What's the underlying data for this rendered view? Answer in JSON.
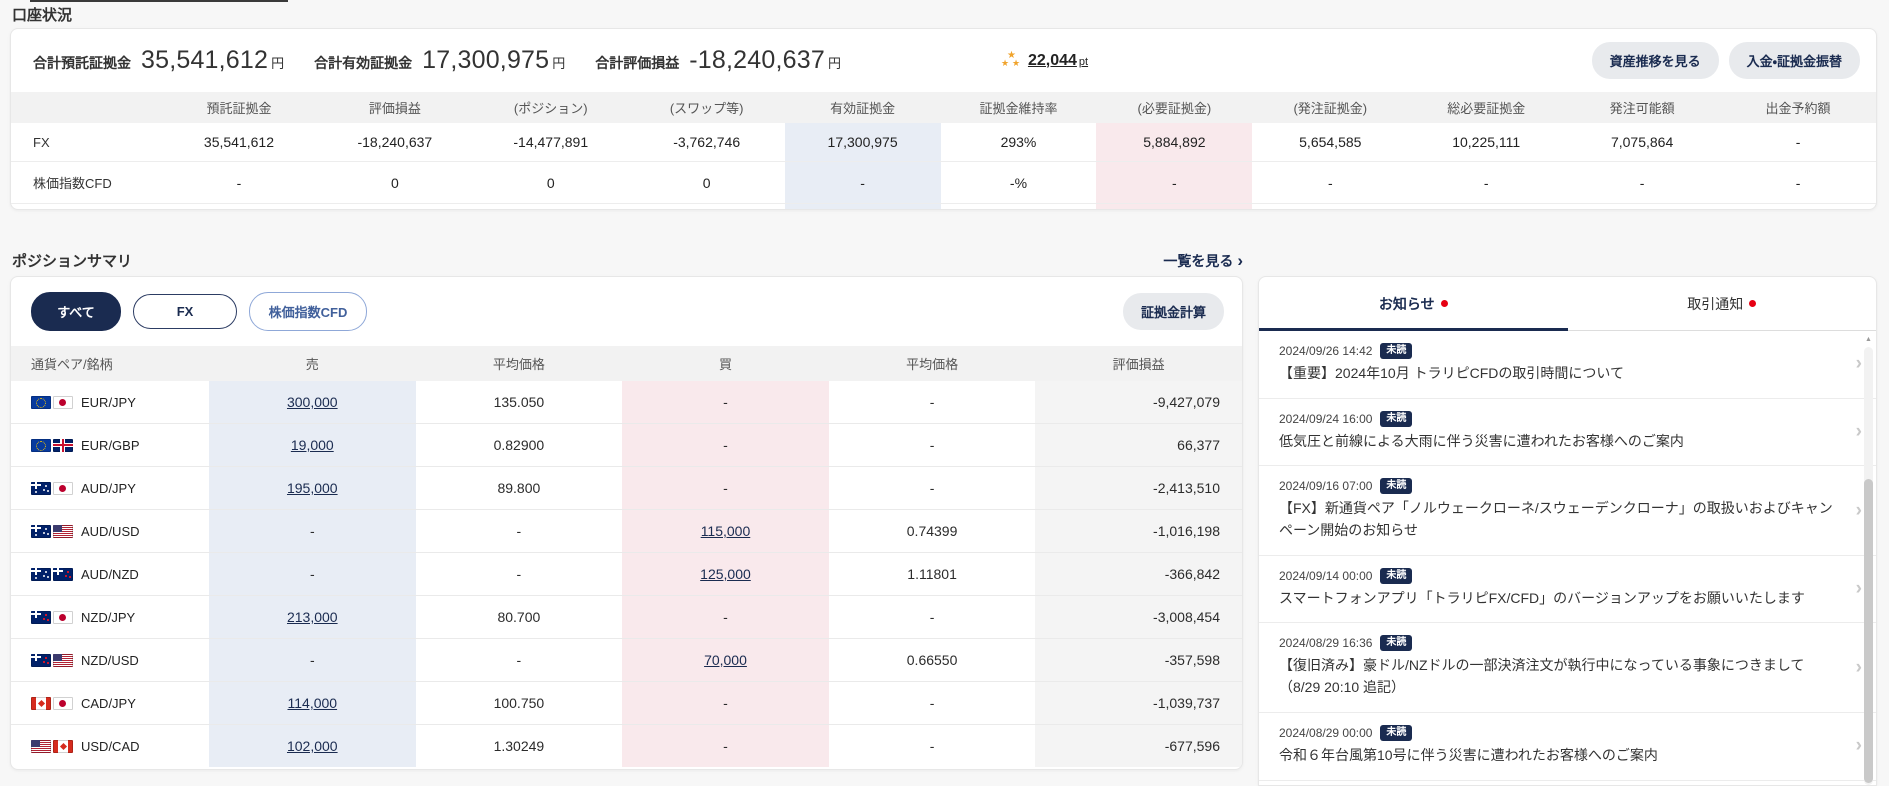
{
  "page": {
    "title": "口座状況"
  },
  "account": {
    "summary": [
      {
        "label": "合計預託証拠金",
        "value": "35,541,612",
        "unit": "円"
      },
      {
        "label": "合計有効証拠金",
        "value": "17,300,975",
        "unit": "円"
      },
      {
        "label": "合計評価損益",
        "value": "-18,240,637",
        "unit": "円"
      }
    ],
    "points": {
      "value": "22,044",
      "unit": "pt"
    },
    "buttons": {
      "asset_trend": "資産推移を見る",
      "deposit": "入金・証拠金振替"
    },
    "table": {
      "columns": [
        "",
        "預託証拠金",
        "評価損益",
        "(ポジション)",
        "(スワップ等)",
        "有効証拠金",
        "証拠金維持率",
        "(必要証拠金)",
        "(発注証拠金)",
        "総必要証拠金",
        "発注可能額",
        "出金予約額"
      ],
      "rows": [
        {
          "label": "FX",
          "values": [
            "35,541,612",
            "-18,240,637",
            "-14,477,891",
            "-3,762,746",
            "17,300,975",
            "293%",
            "5,884,892",
            "5,654,585",
            "10,225,111",
            "7,075,864",
            "-"
          ]
        },
        {
          "label": "株価指数CFD",
          "values": [
            "-",
            "0",
            "0",
            "0",
            "-",
            "-%",
            "-",
            "-",
            "-",
            "-",
            "-"
          ]
        }
      ]
    }
  },
  "positions": {
    "title": "ポジションサマリ",
    "view_all": "一覧を見る",
    "tabs": [
      {
        "label": "すべて",
        "active": true
      },
      {
        "label": "FX",
        "active": false
      },
      {
        "label": "株価指数CFD",
        "active": false
      }
    ],
    "margin_calc_button": "証拠金計算",
    "table": {
      "columns": [
        "通貨ペア/銘柄",
        "売",
        "平均価格",
        "買",
        "平均価格",
        "評価損益"
      ],
      "rows": [
        {
          "pair": "EUR/JPY",
          "flags": [
            "eu",
            "jp"
          ],
          "sell": "300,000",
          "sell_avg": "135.050",
          "buy": "-",
          "buy_avg": "-",
          "pl": "-9,427,079"
        },
        {
          "pair": "EUR/GBP",
          "flags": [
            "eu",
            "gb"
          ],
          "sell": "19,000",
          "sell_avg": "0.82900",
          "buy": "-",
          "buy_avg": "-",
          "pl": "66,377"
        },
        {
          "pair": "AUD/JPY",
          "flags": [
            "au",
            "jp"
          ],
          "sell": "195,000",
          "sell_avg": "89.800",
          "buy": "-",
          "buy_avg": "-",
          "pl": "-2,413,510"
        },
        {
          "pair": "AUD/USD",
          "flags": [
            "au",
            "us"
          ],
          "sell": "-",
          "sell_avg": "-",
          "buy": "115,000",
          "buy_avg": "0.74399",
          "pl": "-1,016,198"
        },
        {
          "pair": "AUD/NZD",
          "flags": [
            "au",
            "nz"
          ],
          "sell": "-",
          "sell_avg": "-",
          "buy": "125,000",
          "buy_avg": "1.11801",
          "pl": "-366,842"
        },
        {
          "pair": "NZD/JPY",
          "flags": [
            "nz",
            "jp"
          ],
          "sell": "213,000",
          "sell_avg": "80.700",
          "buy": "-",
          "buy_avg": "-",
          "pl": "-3,008,454"
        },
        {
          "pair": "NZD/USD",
          "flags": [
            "nz",
            "us"
          ],
          "sell": "-",
          "sell_avg": "-",
          "buy": "70,000",
          "buy_avg": "0.66550",
          "pl": "-357,598"
        },
        {
          "pair": "CAD/JPY",
          "flags": [
            "ca",
            "jp"
          ],
          "sell": "114,000",
          "sell_avg": "100.750",
          "buy": "-",
          "buy_avg": "-",
          "pl": "-1,039,737"
        },
        {
          "pair": "USD/CAD",
          "flags": [
            "us",
            "ca"
          ],
          "sell": "102,000",
          "sell_avg": "1.30249",
          "buy": "-",
          "buy_avg": "-",
          "pl": "-677,596"
        }
      ]
    }
  },
  "news": {
    "tabs": [
      {
        "label": "お知らせ",
        "active": true
      },
      {
        "label": "取引通知",
        "active": false
      }
    ],
    "unread_badge": "未読",
    "items": [
      {
        "datetime": "2024/09/26 14:42",
        "title": "【重要】2024年10月 トラリピCFDの取引時間について"
      },
      {
        "datetime": "2024/09/24 16:00",
        "title": "低気圧と前線による大雨に伴う災害に遭われたお客様へのご案内"
      },
      {
        "datetime": "2024/09/16 07:00",
        "title": "【FX】新通貨ペア「ノルウェークローネ/スウェーデンクローナ」の取扱いおよびキャンペーン開始のお知らせ"
      },
      {
        "datetime": "2024/09/14 00:00",
        "title": "スマートフォンアプリ「トラリピFX/CFD」のバージョンアップをお願いいたします"
      },
      {
        "datetime": "2024/08/29 16:36",
        "title": "【復旧済み】豪ドル/NZドルの一部決済注文が執行中になっている事象につきまして（8/29 20:10 追記）"
      },
      {
        "datetime": "2024/08/29 00:00",
        "title": "令和６年台風第10号に伴う災害に遭われたお客様へのご案内"
      }
    ]
  },
  "colors": {
    "accent_navy": "#1a2b50",
    "unread_red": "#e60012",
    "star_gold": "#f0a32c",
    "sell_col_bg": "#e8edf5",
    "buy_col_bg": "#f9e9ec",
    "pl_col_bg": "#f4f4f4"
  }
}
